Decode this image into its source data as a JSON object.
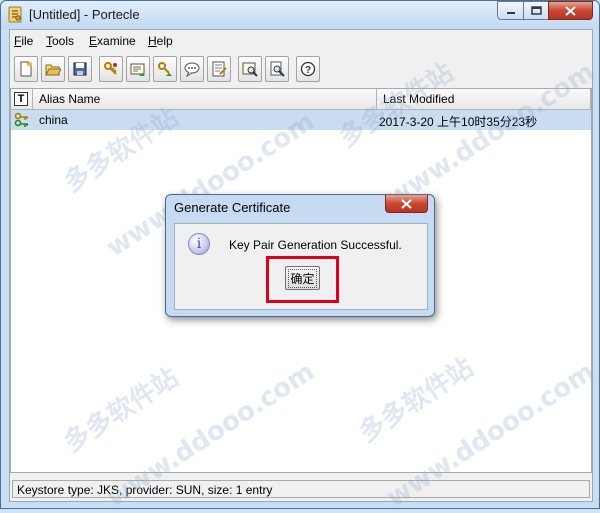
{
  "window": {
    "title": "[Untitled] - Portecle"
  },
  "menu": [
    {
      "accel": "F",
      "rest": "ile"
    },
    {
      "accel": "T",
      "rest": "ools"
    },
    {
      "accel": "E",
      "rest": "xamine"
    },
    {
      "accel": "H",
      "rest": "elp"
    }
  ],
  "toolbar": {
    "icons": [
      "new-keystore-icon",
      "open-keystore-icon",
      "save-keystore-icon",
      "generate-key-pair-icon",
      "import-certificate-icon",
      "import-key-pair-icon",
      "set-password-icon",
      "keystore-report-icon",
      "examine-certificate-icon",
      "examine-file-icon",
      "help-icon"
    ]
  },
  "table": {
    "headers": {
      "type": "T",
      "alias": "Alias Name",
      "modified": "Last Modified"
    },
    "rows": [
      {
        "alias": "china",
        "modified": "2017-3-20 上午10时35分23秒"
      }
    ]
  },
  "status": "Keystore type: JKS, provider: SUN, size: 1 entry",
  "dialog": {
    "title": "Generate Certificate",
    "message": "Key Pair Generation Successful.",
    "ok_label": "确定"
  },
  "colors": {
    "highlight": "#e0001b",
    "selection": "#c9dcf0",
    "close_button": "#c84634"
  },
  "watermark": {
    "brand": "多多软件站",
    "site": "www.ddooo.com"
  }
}
